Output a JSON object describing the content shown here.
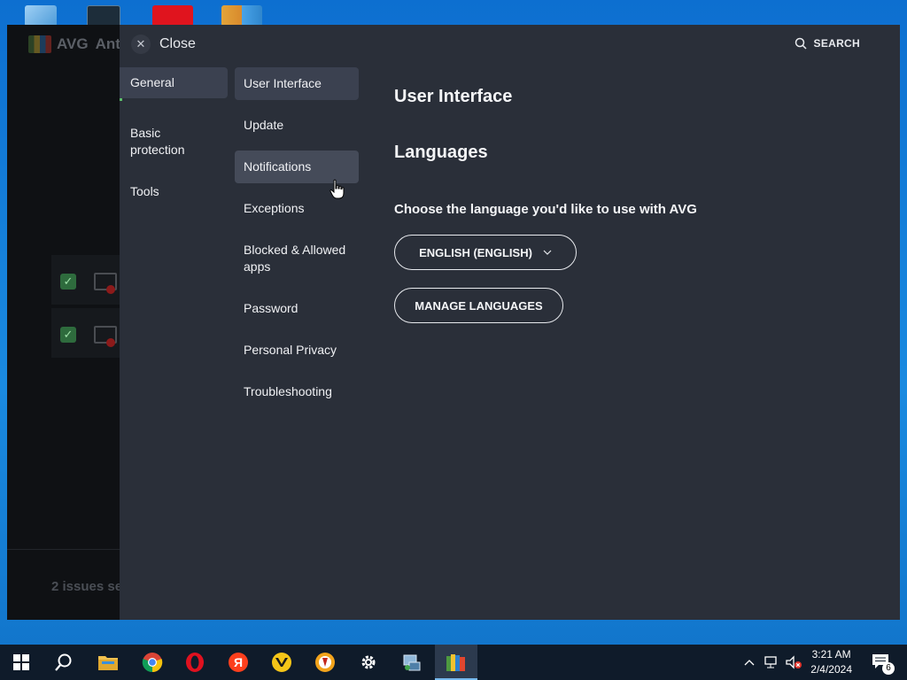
{
  "avg_window": {
    "title_fragment": "AVG",
    "title_rest": "Ant",
    "status_fragment": "2 issues se"
  },
  "settings": {
    "close_label": "Close",
    "search_label": "SEARCH",
    "categories": [
      {
        "label": "General"
      },
      {
        "label": "Basic protection"
      },
      {
        "label": "Tools"
      }
    ],
    "subsections": [
      {
        "label": "User Interface"
      },
      {
        "label": "Update"
      },
      {
        "label": "Notifications"
      },
      {
        "label": "Exceptions"
      },
      {
        "label": "Blocked & Allowed apps"
      },
      {
        "label": "Password"
      },
      {
        "label": "Personal Privacy"
      },
      {
        "label": "Troubleshooting"
      }
    ],
    "content": {
      "title": "User Interface",
      "section_title": "Languages",
      "language_prompt": "Choose the language you'd like to use with AVG",
      "language_selected": "ENGLISH (ENGLISH)",
      "manage_languages_label": "MANAGE LANGUAGES"
    }
  },
  "taskbar": {
    "time": "3:21 AM",
    "date": "2/4/2024",
    "notification_count": "6",
    "icons": [
      "windows-start-icon",
      "search-icon",
      "file-explorer-icon",
      "chrome-icon",
      "opera-icon",
      "yandex-icon",
      "yandex-browser-icon",
      "comodo-dragon-icon",
      "settings-gear-icon",
      "network-tool-icon",
      "avg-icon"
    ]
  },
  "colors": {
    "panel_bg": "#2a2f39",
    "active_item_bg": "#3b4150",
    "accent_green": "#5bbf6a",
    "taskbar_bg": "#0f1b2a"
  }
}
